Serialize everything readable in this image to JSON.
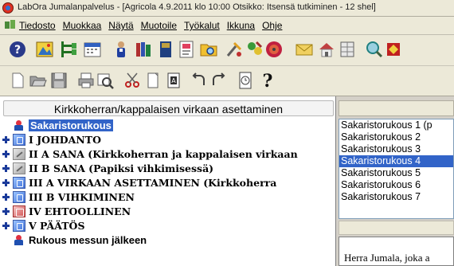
{
  "titlebar": {
    "title": "LabOra Jumalanpalvelus - [Agricola 4.9.2011  klo 10:00 Otsikko: Itsensä tutkiminen - 12 shel]"
  },
  "menubar": {
    "items": [
      {
        "label": "Tiedosto"
      },
      {
        "label": "Muokkaa"
      },
      {
        "label": "Näytä"
      },
      {
        "label": "Muotoile"
      },
      {
        "label": "Työkalut"
      },
      {
        "label": "Ikkuna"
      },
      {
        "label": "Ohje"
      }
    ]
  },
  "toolbar1": {
    "icons": [
      "help-icon",
      "image-icon",
      "tree-icon",
      "calendar-icon",
      "person-icon",
      "books-icon",
      "book-icon",
      "document-icon",
      "search-folder-icon",
      "tools-icon",
      "paint-icon",
      "disc-icon",
      "envelope-icon",
      "house-icon",
      "grid-icon",
      "magnify-icon",
      "gem-icon"
    ]
  },
  "toolbar2": {
    "icons": [
      "new-icon",
      "open-icon",
      "save-icon",
      "print-icon",
      "print-preview-icon",
      "cut-icon",
      "copy-icon",
      "paste-icon",
      "undo-icon",
      "redo-icon",
      "timer-icon",
      "help-question-icon"
    ]
  },
  "left": {
    "header": "Kirkkoherran/kappalaisen virkaan asettaminen",
    "tree": [
      {
        "label": "Sakaristorukous",
        "icon": "prayer",
        "expander": false,
        "selected": true
      },
      {
        "label": "I JOHDANTO",
        "icon": "blue",
        "expander": true
      },
      {
        "label": "II A SANA (Kirkkoherran ja kappalaisen virkaan",
        "icon": "gray",
        "expander": true
      },
      {
        "label": "II B SANA (Papiksi vihkimisessä)",
        "icon": "gray",
        "expander": true
      },
      {
        "label": "III A VIRKAAN ASETTAMINEN (Kirkkoherra",
        "icon": "blue",
        "expander": true
      },
      {
        "label": "III B VIHKIMINEN",
        "icon": "blue",
        "expander": true
      },
      {
        "label": "IV EHTOOLLINEN",
        "icon": "red",
        "expander": true
      },
      {
        "label": "V PÄÄTÖS",
        "icon": "blue",
        "expander": true
      },
      {
        "label": "Rukous messun jälkeen",
        "icon": "prayer",
        "expander": false
      }
    ]
  },
  "right": {
    "list": [
      {
        "label": "Sakaristorukous 1 (p"
      },
      {
        "label": "Sakaristorukous 2"
      },
      {
        "label": "Sakaristorukous 3"
      },
      {
        "label": "Sakaristorukous 4",
        "selected": true
      },
      {
        "label": "Sakaristorukous 5"
      },
      {
        "label": "Sakaristorukous 6"
      },
      {
        "label": "Sakaristorukous 7"
      }
    ],
    "text": "Herra Jumala, joka a"
  },
  "colors": {
    "selection": "#3264c8",
    "chrome": "#ece9d8"
  }
}
